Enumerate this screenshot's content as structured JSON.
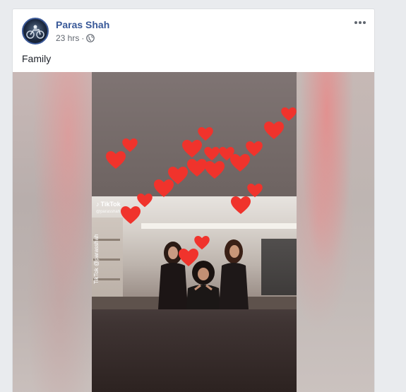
{
  "post": {
    "author": "Paras Shah",
    "time": "23 hrs",
    "separator": "·",
    "privacy_icon": "globe-icon",
    "more_icon": "more-options-icon",
    "caption": "Family"
  },
  "video": {
    "tiktok_label": "TikTok",
    "tiktok_handle": "@parasshah",
    "tiktok_vertical": "TikTok @parasshah",
    "overlay_icon": "heart-icon"
  },
  "colors": {
    "link": "#385898",
    "meta": "#616770",
    "text": "#1d2129",
    "heart": "#f0332c"
  }
}
